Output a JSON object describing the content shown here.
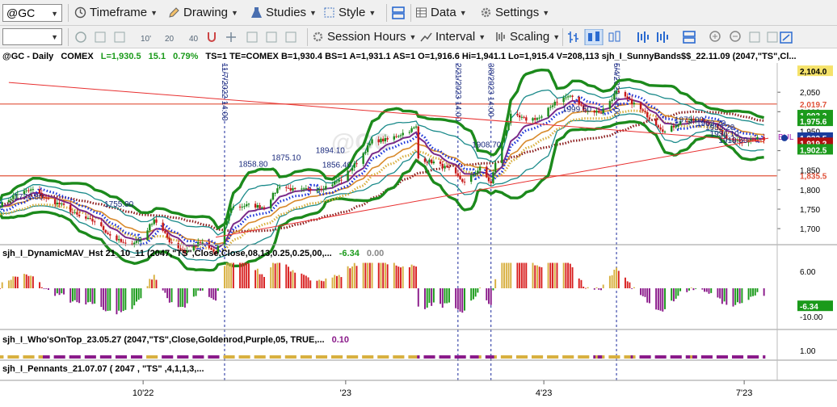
{
  "toolbar": {
    "symbol": "@GC",
    "timeframe": "Timeframe",
    "drawing": "Drawing",
    "studies": "Studies",
    "style": "Style",
    "data": "Data",
    "settings": "Settings",
    "session_hours": "Session Hours",
    "interval": "Interval",
    "scaling": "Scaling"
  },
  "chart_data": {
    "type": "line",
    "header": {
      "symbol": "@GC - Daily",
      "exchange": "COMEX",
      "L": "L=1,930.5",
      "chg": "15.1",
      "pct": "0.79%",
      "rest": "TS=1  TE=COMEX  B=1,930.4  BS=1  A=1,931.1  AS=1  O=1,916.6  Hi=1,941.1  Lo=1,915.4  V=208,113  sjh_I_SunnyBands$$_22.11.09 (2047,\"TS\",Cl..."
    },
    "price_axis": {
      "ticks": [
        2050,
        2000,
        1950,
        1900,
        1850,
        1800,
        1750,
        1700
      ],
      "tick_labels": [
        "2,050",
        "2,000",
        "1,950",
        "1,900",
        "1,850",
        "1,800",
        "1,750",
        "1,700"
      ],
      "range": [
        1665,
        2125
      ],
      "tags": [
        {
          "value": 2104.0,
          "label": "2,104.0",
          "color": "#f5e26a",
          "text_color": "#000000"
        },
        {
          "value": 2019.7,
          "label": "2,019.7",
          "color": "none",
          "text_color": "#e0523a"
        },
        {
          "value": 1990.2,
          "label": "1,993.2",
          "color": "#1c9a1c",
          "text_color": "#ffffff"
        },
        {
          "value": 1975.6,
          "label": "1,975.6",
          "color": "#1c9a1c",
          "text_color": "#ffffff"
        },
        {
          "value": 1932.5,
          "label": "1,932.5",
          "color": "#1a3c9c",
          "text_color": "#ffffff"
        },
        {
          "value": 1919.2,
          "label": "1,919.2",
          "color": "#b01010",
          "text_color": "#ffffff"
        },
        {
          "value": 1902.5,
          "label": "1,902.5",
          "color": "#1c9a1c",
          "text_color": "#ffffff"
        },
        {
          "value": 1835.5,
          "label": "1,835.5",
          "color": "none",
          "text_color": "#e0523a"
        }
      ],
      "bull_label": "BUL"
    },
    "horizontal_levels": [
      2019.7,
      1835.5
    ],
    "trendlines": [
      {
        "from": [
          "2022-08-01",
          2075
        ],
        "to": [
          "2023-07-10",
          1923
        ]
      },
      {
        "from": [
          "2022-11-03",
          1678
        ],
        "to": [
          "2023-07-12",
          1932
        ]
      }
    ],
    "vertical_markers": [
      {
        "date": "2022-11-07",
        "label": "11/7/2022 14:00"
      },
      {
        "date": "2023-02-21",
        "label": "2/21/2023 14:00"
      },
      {
        "date": "2023-03-08",
        "label": "3/8/2023 14:00"
      },
      {
        "date": "2023-05-04",
        "label": "5/4/2023 14:00"
      }
    ],
    "annotations": [
      {
        "date": "2022-08-10",
        "price": 1774.8,
        "text": "1774.80"
      },
      {
        "date": "2022-09-20",
        "price": 1755.9,
        "text": "1755.90"
      },
      {
        "date": "2022-11-20",
        "price": 1858.8,
        "text": "1858.80"
      },
      {
        "date": "2022-12-05",
        "price": 1875.1,
        "text": "1875.10"
      },
      {
        "date": "2022-12-25",
        "price": 1894.1,
        "text": "1894.10"
      },
      {
        "date": "2022-12-28",
        "price": 1856.4,
        "text": "1856.40"
      },
      {
        "date": "2023-03-06",
        "price": 1908.7,
        "text": "1908.70"
      },
      {
        "date": "2023-04-16",
        "price": 1999.5,
        "text": "1999.50"
      },
      {
        "date": "2023-06-06",
        "price": 1973.0,
        "text": "1973.00"
      },
      {
        "date": "2023-06-16",
        "price": 1963.7,
        "text": "1963.70"
      },
      {
        "date": "2023-06-20",
        "price": 1953.2,
        "text": "1953.20"
      },
      {
        "date": "2023-06-22",
        "price": 1936.1,
        "text": "1936.10"
      },
      {
        "date": "2023-06-26",
        "price": 1919.5,
        "text": "1919.50"
      }
    ],
    "price_path": [
      [
        "2022-07-28",
        1760
      ],
      [
        "2022-08-05",
        1790
      ],
      [
        "2022-08-12",
        1800
      ],
      [
        "2022-08-18",
        1776
      ],
      [
        "2022-08-26",
        1758
      ],
      [
        "2022-09-02",
        1730
      ],
      [
        "2022-09-09",
        1718
      ],
      [
        "2022-09-16",
        1683
      ],
      [
        "2022-09-23",
        1658
      ],
      [
        "2022-09-30",
        1672
      ],
      [
        "2022-10-06",
        1725
      ],
      [
        "2022-10-13",
        1668
      ],
      [
        "2022-10-20",
        1640
      ],
      [
        "2022-10-27",
        1665
      ],
      [
        "2022-11-03",
        1637
      ],
      [
        "2022-11-10",
        1755
      ],
      [
        "2022-11-18",
        1760
      ],
      [
        "2022-11-25",
        1755
      ],
      [
        "2022-12-02",
        1810
      ],
      [
        "2022-12-09",
        1798
      ],
      [
        "2022-12-16",
        1800
      ],
      [
        "2022-12-23",
        1808
      ],
      [
        "2022-12-30",
        1826
      ],
      [
        "2023-01-06",
        1870
      ],
      [
        "2023-01-13",
        1925
      ],
      [
        "2023-01-20",
        1928
      ],
      [
        "2023-01-27",
        1945
      ],
      [
        "2023-02-02",
        1960
      ],
      [
        "2023-02-03",
        1880
      ],
      [
        "2023-02-10",
        1870
      ],
      [
        "2023-02-17",
        1852
      ],
      [
        "2023-02-24",
        1818
      ],
      [
        "2023-03-03",
        1855
      ],
      [
        "2023-03-08",
        1815
      ],
      [
        "2023-03-10",
        1870
      ],
      [
        "2023-03-17",
        1990
      ],
      [
        "2023-03-24",
        1980
      ],
      [
        "2023-03-31",
        1985
      ],
      [
        "2023-04-06",
        2026
      ],
      [
        "2023-04-13",
        2041
      ],
      [
        "2023-04-20",
        2003
      ],
      [
        "2023-04-27",
        1999
      ],
      [
        "2023-05-04",
        2050
      ],
      [
        "2023-05-12",
        2020
      ],
      [
        "2023-05-19",
        1985
      ],
      [
        "2023-05-26",
        1948
      ],
      [
        "2023-06-02",
        1974
      ],
      [
        "2023-06-09",
        1978
      ],
      [
        "2023-06-16",
        1970
      ],
      [
        "2023-06-23",
        1932
      ],
      [
        "2023-06-30",
        1925
      ],
      [
        "2023-07-07",
        1930
      ],
      [
        "2023-07-10",
        1930.5
      ]
    ],
    "x_axis": {
      "range": [
        "2022-07-28",
        "2023-07-16"
      ],
      "tick_labels": [
        {
          "date": "2022-10-01",
          "label": "10'22"
        },
        {
          "date": "2023-01-01",
          "label": "'23"
        },
        {
          "date": "2023-04-01",
          "label": "4'23"
        },
        {
          "date": "2023-07-01",
          "label": "7'23"
        }
      ]
    },
    "colors": {
      "band_outer": "#1c8a1c",
      "band_inner": "#1a8a8a",
      "ma_purple": "#7a2a8a",
      "ma_orange": "#d8892a",
      "ma_gold_dots": "#d8b040",
      "ma_maroon_dots": "#8a1a1a",
      "trail_blue_dots": "#1a33d8",
      "candle_up": "#1a8a1a",
      "candle_down": "#c81a1a",
      "hist_gold": "#d8b040",
      "hist_red": "#d82020",
      "hist_green": "#1a9a1a",
      "hist_purple": "#8a1a8a",
      "level_line": "#e0523a",
      "trend_line": "#e83030",
      "marker_line": "#1a2a9c"
    },
    "subpanels": [
      {
        "title": "sjh_I_DynamicMAV_Hst 21_10_11 (2047,\"TS\",Close,Close,08,13,0.25,0.25,00,...",
        "value1": "-6.34",
        "value2": "0.00",
        "ticks": [
          6,
          -10
        ],
        "tick_labels": [
          "6.00",
          "-10.00"
        ],
        "last_tag": "-6.34",
        "range": [
          -14,
          10
        ]
      },
      {
        "title": "sjh_I_Who'sOnTop_23.05.27 (2047,\"TS\",Close,Goldenrod,Purple,05,  TRUE,...",
        "value1": "0.10",
        "ticks": [
          1
        ],
        "tick_labels": [
          "1.00"
        ]
      },
      {
        "title": "sjh_I_Pennants_21.07.07 ( 2047 , \"TS\" ,4,1,1,3,..."
      }
    ],
    "watermark": "@GC"
  }
}
